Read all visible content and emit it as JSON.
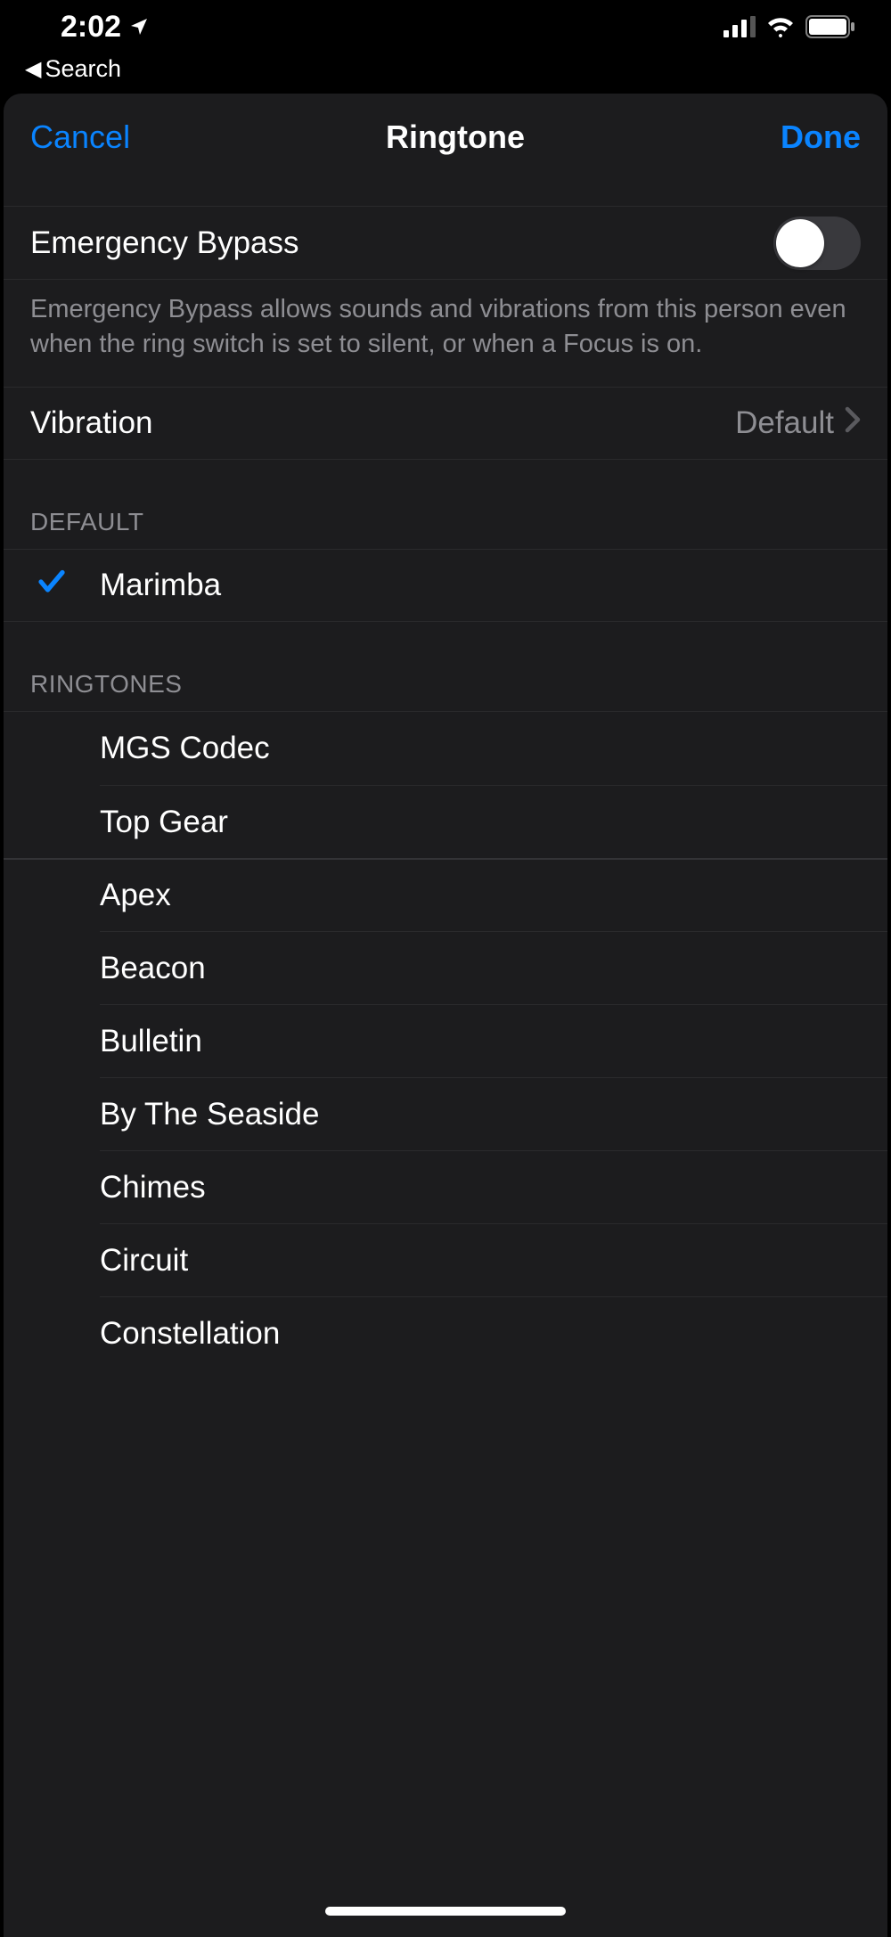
{
  "statusBar": {
    "time": "2:02",
    "backLabel": "Search"
  },
  "nav": {
    "cancel": "Cancel",
    "title": "Ringtone",
    "done": "Done"
  },
  "emergencyBypass": {
    "label": "Emergency Bypass",
    "enabled": false,
    "description": "Emergency Bypass allows sounds and vibrations from this person even when the ring switch is set to silent, or when a Focus is on."
  },
  "vibration": {
    "label": "Vibration",
    "value": "Default"
  },
  "sections": {
    "defaultHeader": "DEFAULT",
    "ringtonesHeader": "RINGTONES"
  },
  "defaultTone": {
    "name": "Marimba",
    "selected": true
  },
  "ringtones": [
    {
      "name": "MGS Codec",
      "selected": false
    },
    {
      "name": "Top Gear",
      "selected": false
    },
    {
      "name": "Apex",
      "selected": false
    },
    {
      "name": "Beacon",
      "selected": false
    },
    {
      "name": "Bulletin",
      "selected": false
    },
    {
      "name": "By The Seaside",
      "selected": false
    },
    {
      "name": "Chimes",
      "selected": false
    },
    {
      "name": "Circuit",
      "selected": false
    },
    {
      "name": "Constellation",
      "selected": false
    }
  ]
}
